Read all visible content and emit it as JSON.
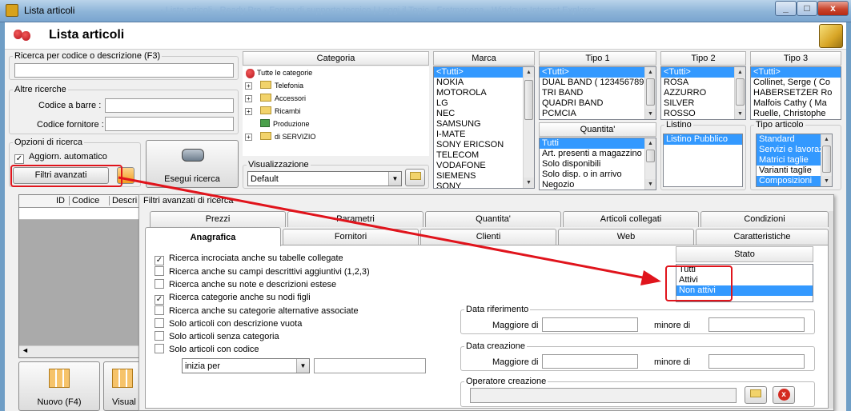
{
  "window": {
    "title": "Lista articoli",
    "bg_title": "· Lista articoli · Ready Pro · Forum di supporto tecnico | Leggi il Topic · Fretmacena · Windows Internet Explorer",
    "min": "_",
    "max": "□",
    "close": "x"
  },
  "header": {
    "title": "Lista articoli"
  },
  "search": {
    "legend": "Ricerca per codice o descrizione (F3)",
    "value": ""
  },
  "altre": {
    "legend": "Altre ricerche",
    "barcode_label": "Codice a barre :",
    "barcode_value": "",
    "supplier_label": "Codice fornitore :",
    "supplier_value": ""
  },
  "opzioni": {
    "legend": "Opzioni di ricerca",
    "auto_label": "Aggiorn. automatico",
    "auto_checked": true,
    "advanced_button": "Filtri avanzati",
    "search_button": "Esegui ricerca"
  },
  "categoria": {
    "header": "Categoria",
    "items": [
      {
        "label": "Tutte le categorie",
        "pm": ""
      },
      {
        "label": "Telefonia",
        "pm": "+"
      },
      {
        "label": "Accessori",
        "pm": "+"
      },
      {
        "label": "Ricambi",
        "pm": "+"
      },
      {
        "label": "Produzione",
        "pm": ""
      },
      {
        "label": "di SERVIZIO",
        "pm": "+"
      }
    ],
    "view_legend": "Visualizzazione",
    "view_value": "Default"
  },
  "marca": {
    "header": "Marca",
    "items": [
      "<Tutti>",
      "NOKIA",
      "MOTOROLA",
      "LG",
      "NEC",
      "SAMSUNG",
      "I-MATE",
      "SONY ERICSON",
      "TELECOM",
      "VODAFONE",
      "SIEMENS",
      "SONY"
    ]
  },
  "tipo1": {
    "header": "Tipo 1",
    "items": [
      "<Tutti>",
      "DUAL BAND ( 123456789",
      "TRI BAND",
      "QUADRI BAND",
      "PCMCIA"
    ]
  },
  "quantita": {
    "header": "Quantita'",
    "items": [
      "Tutti",
      "Art. presenti a magazzino",
      "Solo disponibili",
      "Solo disp. o in arrivo",
      "Negozio"
    ]
  },
  "tipo2": {
    "header": "Tipo 2",
    "items": [
      "<Tutti>",
      "ROSA",
      "AZZURRO",
      "SILVER",
      "ROSSO"
    ]
  },
  "listino": {
    "legend": "Listino",
    "items": [
      "Listino Pubblico"
    ]
  },
  "tipo3": {
    "header": "Tipo 3",
    "items": [
      "<Tutti>",
      "Collinet, Serge ( Co",
      "HABERSETZER Ro",
      "Malfois Cathy ( Ma",
      "Ruelle, Christophe"
    ]
  },
  "tipoart": {
    "legend": "Tipo articolo",
    "items": [
      "Standard",
      "Servizi e lavoraz.",
      "Matrici taglie",
      "Varianti taglie",
      "Composizioni"
    ]
  },
  "grid": {
    "columns": [
      "ID",
      "Codice",
      "Descri"
    ]
  },
  "bottom": {
    "new_label": "Nuovo (F4)",
    "vis_label": "Visual"
  },
  "popup": {
    "title": "Filtri avanzati di ricerca",
    "tabs_back": [
      "Prezzi",
      "Parametri",
      "Quantita'",
      "Articoli collegati",
      "Condizioni"
    ],
    "tabs_front": [
      "Anagrafica",
      "Fornitori",
      "Clienti",
      "Web",
      "Caratteristiche"
    ],
    "checks": [
      {
        "label": "Ricerca incrociata anche su tabelle collegate",
        "checked": true
      },
      {
        "label": "Ricerca anche su campi descrittivi aggiuntivi (1,2,3)",
        "checked": false
      },
      {
        "label": "Ricerca anche su note e descrizioni estese",
        "checked": false
      },
      {
        "label": "Ricerca categorie anche su nodi figli",
        "checked": true
      },
      {
        "label": "Ricerca anche su categorie alternative associate",
        "checked": false
      },
      {
        "label": "Solo articoli con descrizione vuota",
        "checked": false
      },
      {
        "label": "Solo articoli senza categoria",
        "checked": false
      },
      {
        "label": "Solo articoli con codice",
        "checked": false
      }
    ],
    "code_mode": "inizia per",
    "code_value": "",
    "stato": {
      "header": "Stato",
      "items": [
        "Tutti",
        "Attivi",
        "Non attivi"
      ],
      "selected": 2
    },
    "data_rif": {
      "legend": "Data riferimento",
      "greater": "Maggiore di",
      "less": "minore di"
    },
    "data_cre": {
      "legend": "Data creazione",
      "greater": "Maggiore di",
      "less": "minore di"
    },
    "operatore": {
      "legend": "Operatore creazione",
      "value": ""
    }
  },
  "colors": {
    "selection": "#3399ff",
    "annotation": "#e0141c"
  }
}
